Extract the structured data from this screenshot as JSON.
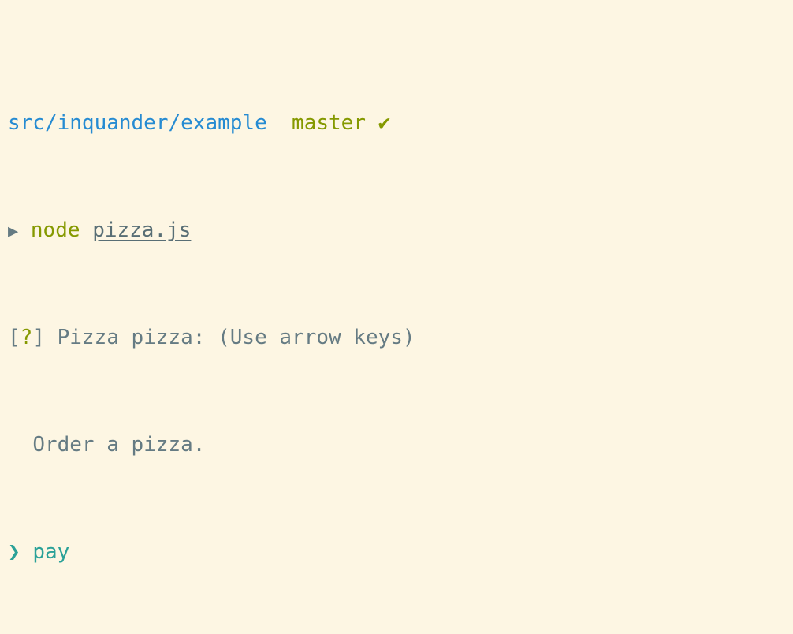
{
  "prompt": {
    "path": "src/inquander/example",
    "branch": "master",
    "status_glyph": "✔",
    "prompt_glyph": "▶",
    "command": "node",
    "argument": "pizza.js"
  },
  "question": {
    "open_bracket": "[",
    "marker": "?",
    "close_bracket": "]",
    "text": "Pizza pizza: (Use arrow keys)",
    "description": "Order a pizza."
  },
  "choices": {
    "cursor_glyph": "❯",
    "items": [
      {
        "label": "pay",
        "selected": true
      }
    ]
  },
  "colors": {
    "background": "#fdf6e3",
    "path": "#268bd2",
    "branch": "#859900",
    "text": "#657b83",
    "selected": "#2aa198"
  }
}
